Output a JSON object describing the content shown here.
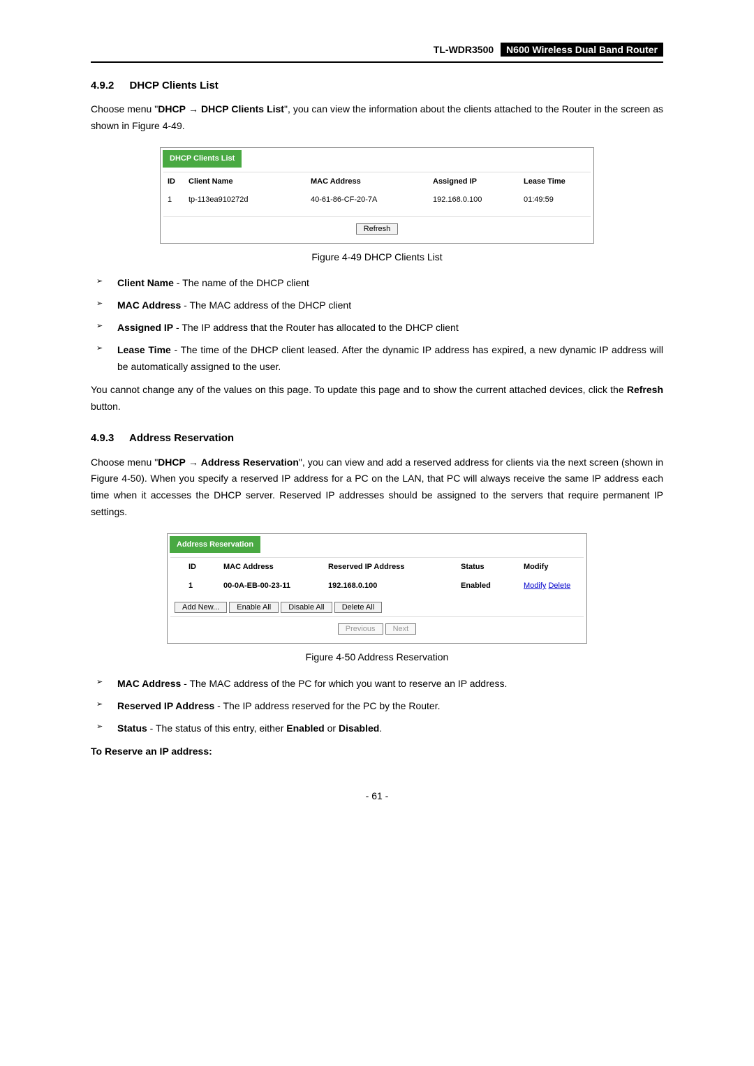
{
  "header": {
    "model": "TL-WDR3500",
    "title": "N600 Wireless Dual Band Router"
  },
  "section1": {
    "number": "4.9.2",
    "heading": "DHCP Clients List",
    "intro_pre": "Choose menu \"",
    "menu1": "DHCP",
    "menu2": "DHCP Clients List",
    "intro_post": "\", you can view the information about the clients attached to the Router in the screen as shown in Figure 4-49."
  },
  "fig1": {
    "title": "DHCP Clients List",
    "headers": {
      "id": "ID",
      "client": "Client Name",
      "mac": "MAC Address",
      "ip": "Assigned IP",
      "lease": "Lease Time"
    },
    "row": {
      "id": "1",
      "client": "tp-113ea910272d",
      "mac": "40-61-86-CF-20-7A",
      "ip": "192.168.0.100",
      "lease": "01:49:59"
    },
    "refresh": "Refresh",
    "caption": "Figure 4-49 DHCP Clients List"
  },
  "bullets1": [
    {
      "term": "Client Name",
      "desc": " - The name of the DHCP client"
    },
    {
      "term": "MAC Address",
      "desc": " - The MAC address of the DHCP client"
    },
    {
      "term": "Assigned IP",
      "desc": " - The IP address that the Router has allocated to the DHCP client"
    },
    {
      "term": "Lease Time",
      "desc": " - The time of the DHCP client leased. After the dynamic IP address has expired, a new dynamic IP address will be automatically assigned to the user."
    }
  ],
  "paragraph1_a": "You cannot change any of the values on this page. To update this page and to show the current attached devices, click the ",
  "paragraph1_b": "Refresh",
  "paragraph1_c": " button.",
  "section2": {
    "number": "4.9.3",
    "heading": "Address Reservation",
    "intro_pre": "Choose menu \"",
    "menu1": "DHCP",
    "menu2": "Address Reservation",
    "intro_post": "\", you can view and add a reserved address for clients via the next screen (shown in Figure 4-50). When you specify a reserved IP address for a PC on the LAN, that PC will always receive the same IP address each time when it accesses the DHCP server. Reserved IP addresses should be assigned to the servers that require permanent IP settings."
  },
  "fig2": {
    "title": "Address Reservation",
    "headers": {
      "id": "ID",
      "mac": "MAC Address",
      "ip": "Reserved IP Address",
      "status": "Status",
      "modify": "Modify"
    },
    "row": {
      "id": "1",
      "mac": "00-0A-EB-00-23-11",
      "ip": "192.168.0.100",
      "status": "Enabled",
      "modify": "Modify",
      "delete": "Delete"
    },
    "buttons": {
      "add": "Add New...",
      "enable": "Enable All",
      "disable": "Disable All",
      "delete": "Delete All",
      "prev": "Previous",
      "next": "Next"
    },
    "caption": "Figure 4-50 Address Reservation"
  },
  "bullets2": [
    {
      "term": "MAC Address",
      "desc": " - The MAC address of the PC for which you want to reserve an IP address."
    },
    {
      "term": "Reserved IP Address",
      "desc": " - The IP address reserved for the PC by the Router."
    },
    {
      "term": "Status",
      "desc_a": " - The status of this entry, either ",
      "b1": "Enabled",
      "desc_b": " or ",
      "b2": "Disabled",
      "desc_c": "."
    }
  ],
  "reserve_heading": "To Reserve an IP address:",
  "page_number": "- 61 -"
}
